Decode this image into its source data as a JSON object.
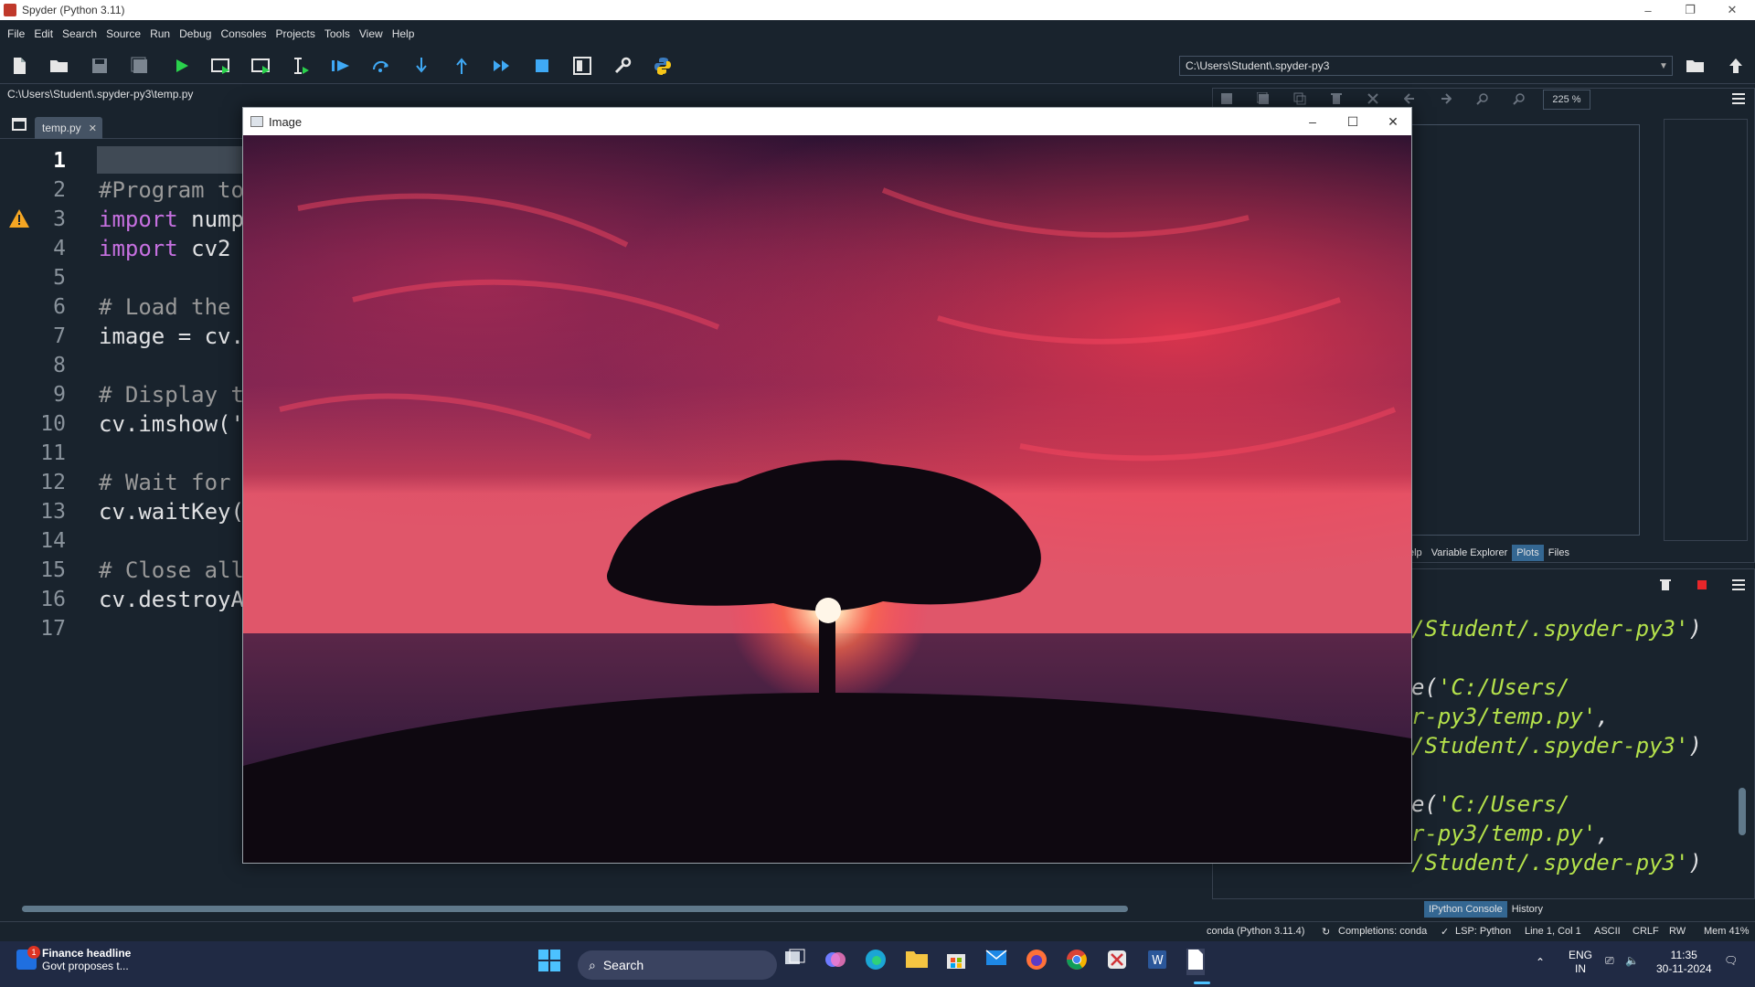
{
  "window": {
    "title": "Spyder (Python 3.11)"
  },
  "menu": [
    "File",
    "Edit",
    "Search",
    "Source",
    "Run",
    "Debug",
    "Consoles",
    "Projects",
    "Tools",
    "View",
    "Help"
  ],
  "toolbar": {
    "working_dir": "C:\\Users\\Student\\.spyder-py3",
    "icons": [
      "new-file-icon",
      "open-file-icon",
      "save-icon",
      "save-all-icon",
      "run-icon",
      "run-cell-icon",
      "run-cell-advance-icon",
      "run-selection-icon",
      "debug-icon",
      "step-icon",
      "step-into-icon",
      "step-return-icon",
      "continue-icon",
      "stop-icon",
      "maximize-pane-icon",
      "preferences-icon",
      "python-path-icon"
    ]
  },
  "editor": {
    "file_path": "C:\\Users\\Student\\.spyder-py3\\temp.py",
    "tab_label": "temp.py",
    "line_numbers": [
      "1",
      "2",
      "3",
      "4",
      "5",
      "6",
      "7",
      "8",
      "9",
      "10",
      "11",
      "12",
      "13",
      "14",
      "15",
      "16",
      "17"
    ],
    "lines": [
      {
        "kw": "",
        "text": "",
        "comment": ""
      },
      {
        "kw": "",
        "text": "",
        "comment": "#Program to"
      },
      {
        "kw": "import",
        "text": " nump",
        "comment": ""
      },
      {
        "kw": "import",
        "text": " cv2",
        "comment": ""
      },
      {
        "kw": "",
        "text": "",
        "comment": ""
      },
      {
        "kw": "",
        "text": "",
        "comment": "# Load the"
      },
      {
        "kw": "",
        "text": "image = cv.",
        "comment": ""
      },
      {
        "kw": "",
        "text": "",
        "comment": ""
      },
      {
        "kw": "",
        "text": "",
        "comment": "# Display t"
      },
      {
        "kw": "",
        "text": "cv.imshow('",
        "comment": ""
      },
      {
        "kw": "",
        "text": "",
        "comment": ""
      },
      {
        "kw": "",
        "text": "",
        "comment": "# Wait for"
      },
      {
        "kw": "",
        "text": "cv.waitKey(",
        "comment": ""
      },
      {
        "kw": "",
        "text": "",
        "comment": ""
      },
      {
        "kw": "",
        "text": "",
        "comment": "# Close all"
      },
      {
        "kw": "",
        "text": "cv.destroyA",
        "comment": ""
      },
      {
        "kw": "",
        "text": "",
        "comment": ""
      }
    ]
  },
  "plots_pane": {
    "zoom": "225 %",
    "tabs": [
      "elp",
      "Variable Explorer",
      "Plots",
      "Files"
    ],
    "active_tab": "Plots"
  },
  "console": {
    "lines": [
      {
        "pre": "",
        "str": "/Student/.spyder-py3'",
        "post": ")"
      },
      {
        "pre": "e(",
        "str": "'C:/Users/",
        "post": ""
      },
      {
        "pre": "",
        "str": "r-py3/temp.py'",
        "post": ","
      },
      {
        "pre": "",
        "str": "/Student/.spyder-py3'",
        "post": ")"
      },
      {
        "pre": "e(",
        "str": "'C:/Users/",
        "post": ""
      },
      {
        "pre": "",
        "str": "r-py3/temp.py'",
        "post": ","
      },
      {
        "pre": "",
        "str": "/Student/.spyder-py3'",
        "post": ")"
      }
    ],
    "tabs": [
      "IPython Console",
      "History"
    ],
    "active_tab": "IPython Console"
  },
  "statusbar": {
    "env": "conda (Python 3.11.4)",
    "completions": "Completions: conda",
    "lsp": "LSP: Python",
    "position": "Line 1, Col 1",
    "encoding": "ASCII",
    "eol": "CRLF",
    "mode": "RW",
    "memory": "Mem 41%"
  },
  "image_window": {
    "title": "Image"
  },
  "taskbar": {
    "news_title": "Finance headline",
    "news_sub": "Govt proposes t...",
    "news_badge": "1",
    "search": "Search",
    "lang1": "ENG",
    "lang2": "IN",
    "time": "11:35",
    "date": "30-11-2024"
  },
  "colors": {
    "background": "#19232d",
    "keyword": "#c670e0",
    "comment": "#999999",
    "console_string": "#b4e14b",
    "active_tab": "#346792"
  }
}
